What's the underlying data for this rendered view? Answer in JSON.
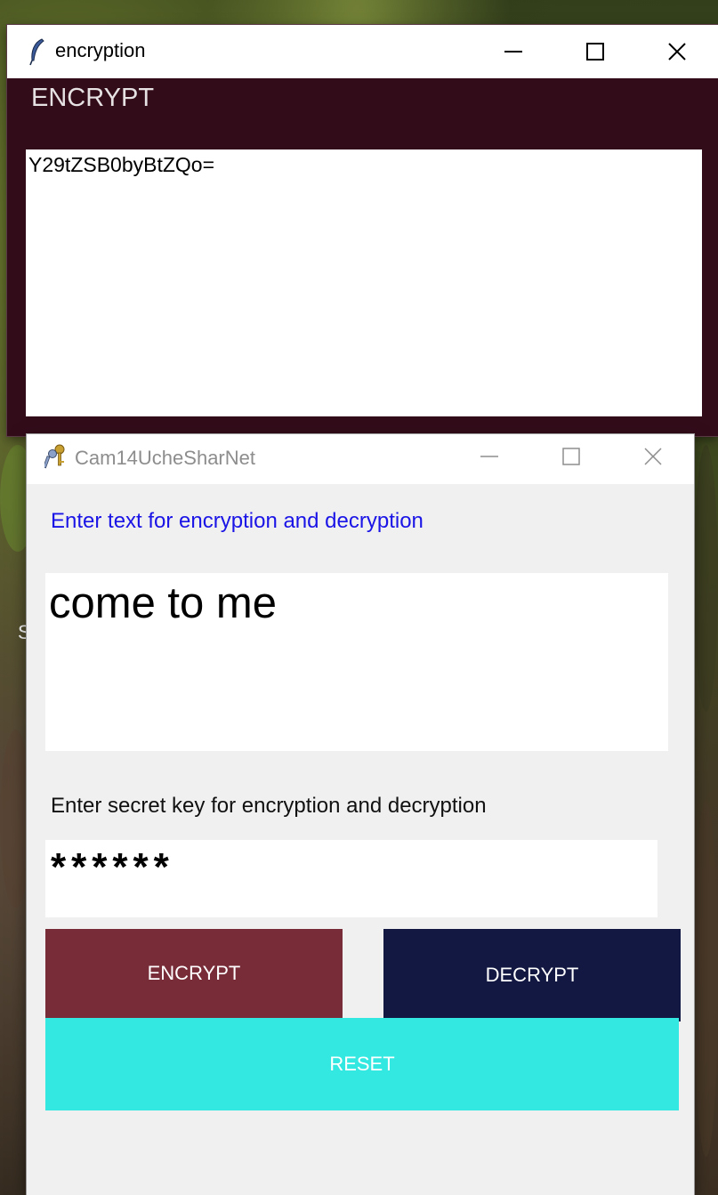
{
  "desktop": {
    "stray_text": "S"
  },
  "encryption_window": {
    "title": "encryption",
    "heading": "ENCRYPT",
    "output": "Y29tZSB0byBtZQo=",
    "icon": "feather-icon"
  },
  "main_window": {
    "title": "Cam14UcheSharNet",
    "icon": "keys-icon",
    "text_label": "Enter text for encryption and decryption",
    "text_value": "come to me",
    "key_label": "Enter secret key for encryption and decryption",
    "key_value": "******",
    "encrypt_label": "ENCRYPT",
    "decrypt_label": "DECRYPT",
    "reset_label": "RESET"
  },
  "colors": {
    "encrypt_window_bg": "#330c1a",
    "encrypt_button": "#782c38",
    "decrypt_button": "#131842",
    "reset_button": "#32e8e0",
    "text_label": "#1a14e6"
  }
}
